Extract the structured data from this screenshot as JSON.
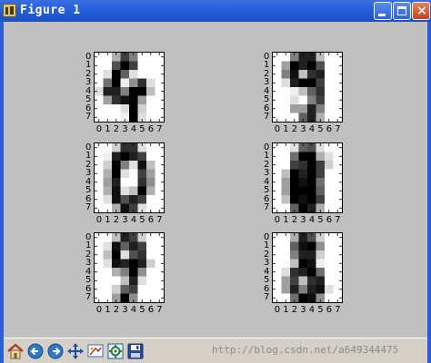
{
  "window": {
    "title": "Figure 1"
  },
  "ticks": [
    "0",
    "1",
    "2",
    "3",
    "4",
    "5",
    "6",
    "7"
  ],
  "digits": [
    {
      "pixels": [
        [
          0,
          0,
          5,
          12,
          8,
          0,
          0,
          0
        ],
        [
          0,
          0,
          11,
          16,
          12,
          0,
          0,
          0
        ],
        [
          0,
          2,
          16,
          10,
          2,
          0,
          0,
          0
        ],
        [
          0,
          9,
          16,
          1,
          7,
          13,
          2,
          0
        ],
        [
          2,
          14,
          14,
          8,
          16,
          16,
          4,
          0
        ],
        [
          0,
          6,
          13,
          15,
          16,
          6,
          0,
          0
        ],
        [
          0,
          0,
          0,
          2,
          16,
          3,
          0,
          0
        ],
        [
          0,
          0,
          0,
          1,
          16,
          2,
          0,
          0
        ]
      ]
    },
    {
      "pixels": [
        [
          0,
          0,
          8,
          14,
          14,
          4,
          0,
          0
        ],
        [
          0,
          6,
          16,
          14,
          16,
          11,
          0,
          0
        ],
        [
          0,
          8,
          15,
          4,
          13,
          14,
          0,
          0
        ],
        [
          0,
          2,
          14,
          16,
          16,
          12,
          0,
          0
        ],
        [
          0,
          0,
          1,
          4,
          10,
          13,
          0,
          0
        ],
        [
          0,
          0,
          2,
          0,
          8,
          12,
          0,
          0
        ],
        [
          0,
          0,
          6,
          6,
          14,
          8,
          0,
          0
        ],
        [
          0,
          0,
          0,
          10,
          14,
          5,
          0,
          0
        ]
      ]
    },
    {
      "pixels": [
        [
          0,
          0,
          3,
          13,
          13,
          2,
          0,
          0
        ],
        [
          0,
          1,
          14,
          16,
          14,
          12,
          0,
          0
        ],
        [
          0,
          3,
          16,
          8,
          2,
          15,
          4,
          0
        ],
        [
          0,
          5,
          16,
          2,
          0,
          12,
          6,
          0
        ],
        [
          0,
          6,
          14,
          0,
          0,
          13,
          7,
          0
        ],
        [
          0,
          5,
          15,
          2,
          4,
          16,
          5,
          0
        ],
        [
          0,
          2,
          15,
          11,
          14,
          12,
          0,
          0
        ],
        [
          0,
          0,
          5,
          15,
          12,
          2,
          0,
          0
        ]
      ]
    },
    {
      "pixels": [
        [
          0,
          0,
          2,
          10,
          11,
          2,
          0,
          0
        ],
        [
          0,
          0,
          9,
          16,
          16,
          5,
          2,
          0
        ],
        [
          0,
          0,
          12,
          13,
          16,
          12,
          3,
          0
        ],
        [
          0,
          4,
          16,
          14,
          16,
          12,
          0,
          0
        ],
        [
          0,
          6,
          16,
          15,
          16,
          9,
          0,
          0
        ],
        [
          0,
          6,
          16,
          16,
          16,
          10,
          0,
          0
        ],
        [
          0,
          4,
          16,
          15,
          16,
          12,
          0,
          0
        ],
        [
          0,
          0,
          10,
          16,
          14,
          5,
          0,
          0
        ]
      ]
    },
    {
      "pixels": [
        [
          0,
          0,
          4,
          14,
          12,
          3,
          0,
          0
        ],
        [
          0,
          2,
          15,
          10,
          14,
          12,
          0,
          0
        ],
        [
          0,
          4,
          16,
          2,
          11,
          13,
          0,
          0
        ],
        [
          0,
          2,
          15,
          14,
          16,
          14,
          3,
          0
        ],
        [
          0,
          0,
          5,
          8,
          16,
          7,
          0,
          0
        ],
        [
          0,
          0,
          0,
          4,
          14,
          2,
          0,
          0
        ],
        [
          0,
          0,
          3,
          10,
          12,
          0,
          0,
          0
        ],
        [
          0,
          0,
          6,
          16,
          7,
          0,
          0,
          0
        ]
      ]
    },
    {
      "pixels": [
        [
          0,
          0,
          5,
          14,
          11,
          3,
          0,
          0
        ],
        [
          0,
          0,
          10,
          15,
          16,
          7,
          0,
          0
        ],
        [
          0,
          0,
          8,
          14,
          14,
          3,
          0,
          0
        ],
        [
          0,
          0,
          4,
          16,
          15,
          1,
          0,
          0
        ],
        [
          0,
          2,
          13,
          14,
          16,
          9,
          0,
          0
        ],
        [
          0,
          6,
          12,
          4,
          13,
          14,
          0,
          0
        ],
        [
          0,
          6,
          14,
          8,
          14,
          15,
          2,
          0
        ],
        [
          0,
          0,
          9,
          16,
          15,
          7,
          0,
          0
        ]
      ]
    }
  ],
  "toolbar": {
    "items": [
      {
        "name": "home-button",
        "icon": "home-icon"
      },
      {
        "name": "back-button",
        "icon": "arrow-left-icon"
      },
      {
        "name": "forward-button",
        "icon": "arrow-right-icon"
      },
      {
        "name": "pan-button",
        "icon": "move-icon"
      },
      {
        "name": "zoom-button",
        "icon": "zoom-rect-icon"
      },
      {
        "name": "subplots-button",
        "icon": "subplots-config-icon"
      },
      {
        "name": "save-button",
        "icon": "floppy-disk-icon"
      }
    ],
    "watermark": "http://blog.csdn.net/a649344475"
  },
  "colors": {
    "titlebar": "#245edb",
    "figure_background": "#c0c0c0",
    "toolbar_background": "#d4d0c8"
  }
}
